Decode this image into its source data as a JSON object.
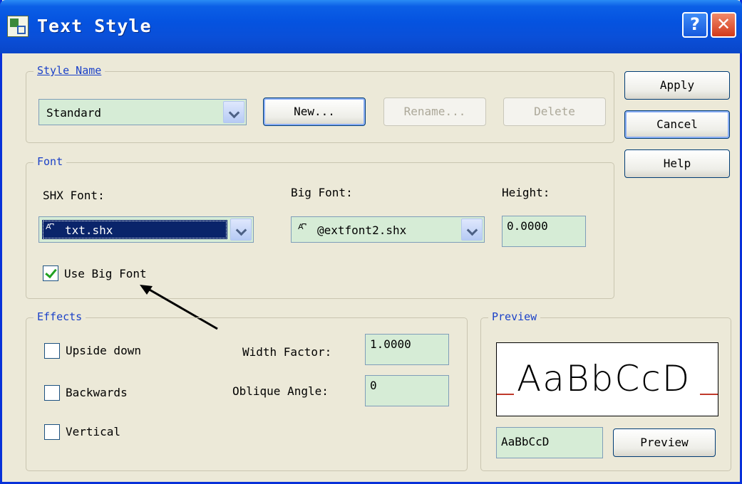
{
  "window": {
    "title": "Text Style",
    "help_button": "?",
    "close_button": "✕"
  },
  "style_name": {
    "legend": "Style Name",
    "selected": "Standard",
    "new_button": "New...",
    "rename_button": "Rename...",
    "delete_button": "Delete"
  },
  "actions": {
    "apply": "Apply",
    "cancel": "Cancel",
    "help": "Help"
  },
  "font": {
    "legend": "Font",
    "shx_label": "SHX Font:",
    "shx_value": "txt.shx",
    "big_font_label": "Big Font:",
    "big_font_value": "@extfont2.shx",
    "height_label": "Height:",
    "height_value": "0.0000",
    "use_big_font_label": "Use Big Font",
    "use_big_font_checked": true,
    "font_icon": "shx-font-icon"
  },
  "effects": {
    "legend": "Effects",
    "upside_down_label": "Upside down",
    "upside_down_checked": false,
    "backwards_label": "Backwards",
    "backwards_checked": false,
    "vertical_label": "Vertical",
    "vertical_checked": false,
    "width_factor_label": "Width Factor:",
    "width_factor_value": "1.0000",
    "oblique_angle_label": "Oblique Angle:",
    "oblique_angle_value": "0"
  },
  "preview": {
    "legend": "Preview",
    "sample_text": "AaBbCcD",
    "input_value": "AaBbCcD",
    "button": "Preview"
  },
  "colors": {
    "titlebar": "#0553e0",
    "dialog_bg": "#ece9d8",
    "legend_text": "#1b41c8",
    "field_bg": "#d6ecd6",
    "selection": "#0a246a",
    "baseline": "#c0392b"
  }
}
